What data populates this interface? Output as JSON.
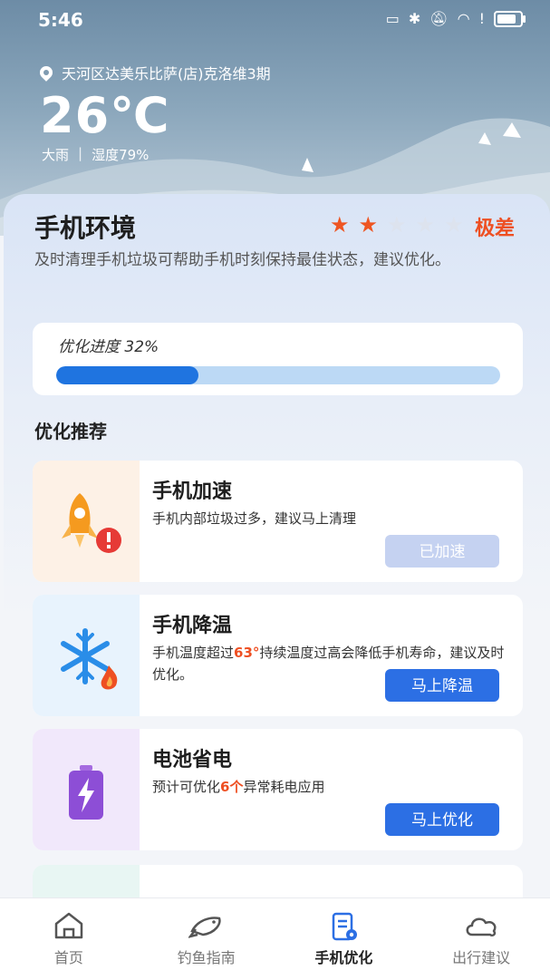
{
  "status_bar": {
    "time": "5:46",
    "icons": [
      "cast-icon",
      "bluetooth-icon",
      "mute-bell-icon",
      "wifi-icon",
      "alert-icon",
      "battery-icon"
    ]
  },
  "weather": {
    "location": "天河区达美乐比萨(店)克洛维3期",
    "temperature": "26℃",
    "condition": "大雨",
    "separator": "|",
    "humidity": "湿度79%"
  },
  "environment": {
    "title": "手机环境",
    "stars_total": 5,
    "stars_filled": 2,
    "rating_label": "极差",
    "description": "及时清理手机垃圾可帮助手机时刻保持最佳状态，建议优化。",
    "progress_label": "优化进度 32%",
    "progress_value": 32
  },
  "recommendations": {
    "section_title": "优化推荐",
    "items": [
      {
        "title": "手机加速",
        "desc": "手机内部垃圾过多，建议马上清理",
        "button": "已加速",
        "icon": "rocket-icon"
      },
      {
        "title": "手机降温",
        "desc_before": "手机温度超过",
        "desc_highlight": "63°",
        "desc_after": "持续温度过高会降低手机寿命，建议及时优化。",
        "button": "马上降温",
        "icon": "snowflake-icon"
      },
      {
        "title": "电池省电",
        "desc_before": "预计可优化",
        "desc_highlight": "6个",
        "desc_after": "异常耗电应用",
        "button": "马上优化",
        "icon": "battery-charge-icon"
      }
    ]
  },
  "tabs": [
    {
      "label": "首页",
      "icon": "home-icon",
      "active": false
    },
    {
      "label": "钓鱼指南",
      "icon": "fish-icon",
      "active": false
    },
    {
      "label": "手机优化",
      "icon": "phone-optimize-icon",
      "active": true
    },
    {
      "label": "出行建议",
      "icon": "cloud-icon",
      "active": false
    }
  ],
  "colors": {
    "accent": "#2c6fe4",
    "warning": "#ee4f22",
    "progress_fill": "#1f74e0",
    "progress_track": "#bcd9f5"
  }
}
